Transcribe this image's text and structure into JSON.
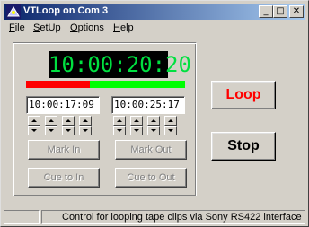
{
  "window": {
    "title": "VTLoop on Com 3"
  },
  "caption_buttons": {
    "minimize": "_",
    "maximize": "□",
    "close": "✕"
  },
  "menu": [
    {
      "label": "File",
      "accel": "F",
      "rest": "ile"
    },
    {
      "label": "SetUp",
      "accel": "S",
      "rest": "etUp"
    },
    {
      "label": "Options",
      "accel": "O",
      "rest": "ptions"
    },
    {
      "label": "Help",
      "accel": "H",
      "rest": "elp"
    }
  ],
  "timecode": {
    "current": "10:00:20:20"
  },
  "progress": {
    "fraction": 0.4,
    "played_color": "#ff0000",
    "remaining_color": "#00ff00"
  },
  "mark_in": {
    "value": "10:00:17:09",
    "button_label": "Mark In",
    "cue_label": "Cue to In"
  },
  "mark_out": {
    "value": "10:00:25:17",
    "button_label": "Mark Out",
    "cue_label": "Cue to Out"
  },
  "actions": {
    "loop_label": "Loop",
    "loop_color": "#ff0000",
    "stop_label": "Stop"
  },
  "status": {
    "message": "Control for looping tape clips via Sony RS422 interface"
  }
}
